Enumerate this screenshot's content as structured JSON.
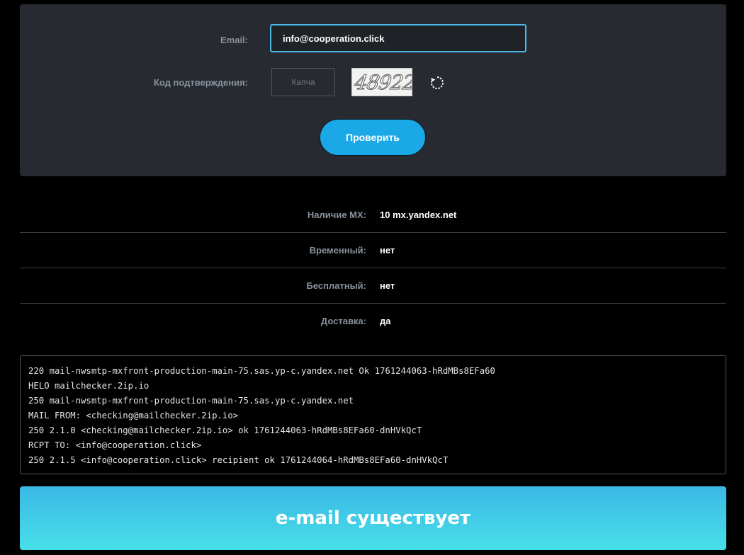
{
  "form": {
    "email_label": "Email:",
    "email_value": "info@cooperation.click",
    "captcha_label": "Код подтверждения:",
    "captcha_placeholder": "Капча",
    "captcha_image_text": "48922",
    "refresh_icon": "refresh-icon",
    "submit_label": "Проверить",
    "accent_color": "#1aa8e6"
  },
  "results": [
    {
      "label": "Наличие MX:",
      "value": "10 mx.yandex.net"
    },
    {
      "label": "Временный:",
      "value": "нет"
    },
    {
      "label": "Бесплатный:",
      "value": "нет"
    },
    {
      "label": "Доставка:",
      "value": "да"
    }
  ],
  "log": [
    "220 mail-nwsmtp-mxfront-production-main-75.sas.yp-c.yandex.net Ok 1761244063-hRdMBs8EFa60",
    "HELO mailchecker.2ip.io",
    "250 mail-nwsmtp-mxfront-production-main-75.sas.yp-c.yandex.net",
    "MAIL FROM: <checking@mailchecker.2ip.io>",
    "250 2.1.0 <checking@mailchecker.2ip.io> ok 1761244063-hRdMBs8EFa60-dnHVkQcT",
    "RCPT TO: <info@cooperation.click>",
    "250 2.1.5 <info@cooperation.click> recipient ok 1761244064-hRdMBs8EFa60-dnHVkQcT"
  ],
  "banner": {
    "text": "e-mail существует"
  }
}
